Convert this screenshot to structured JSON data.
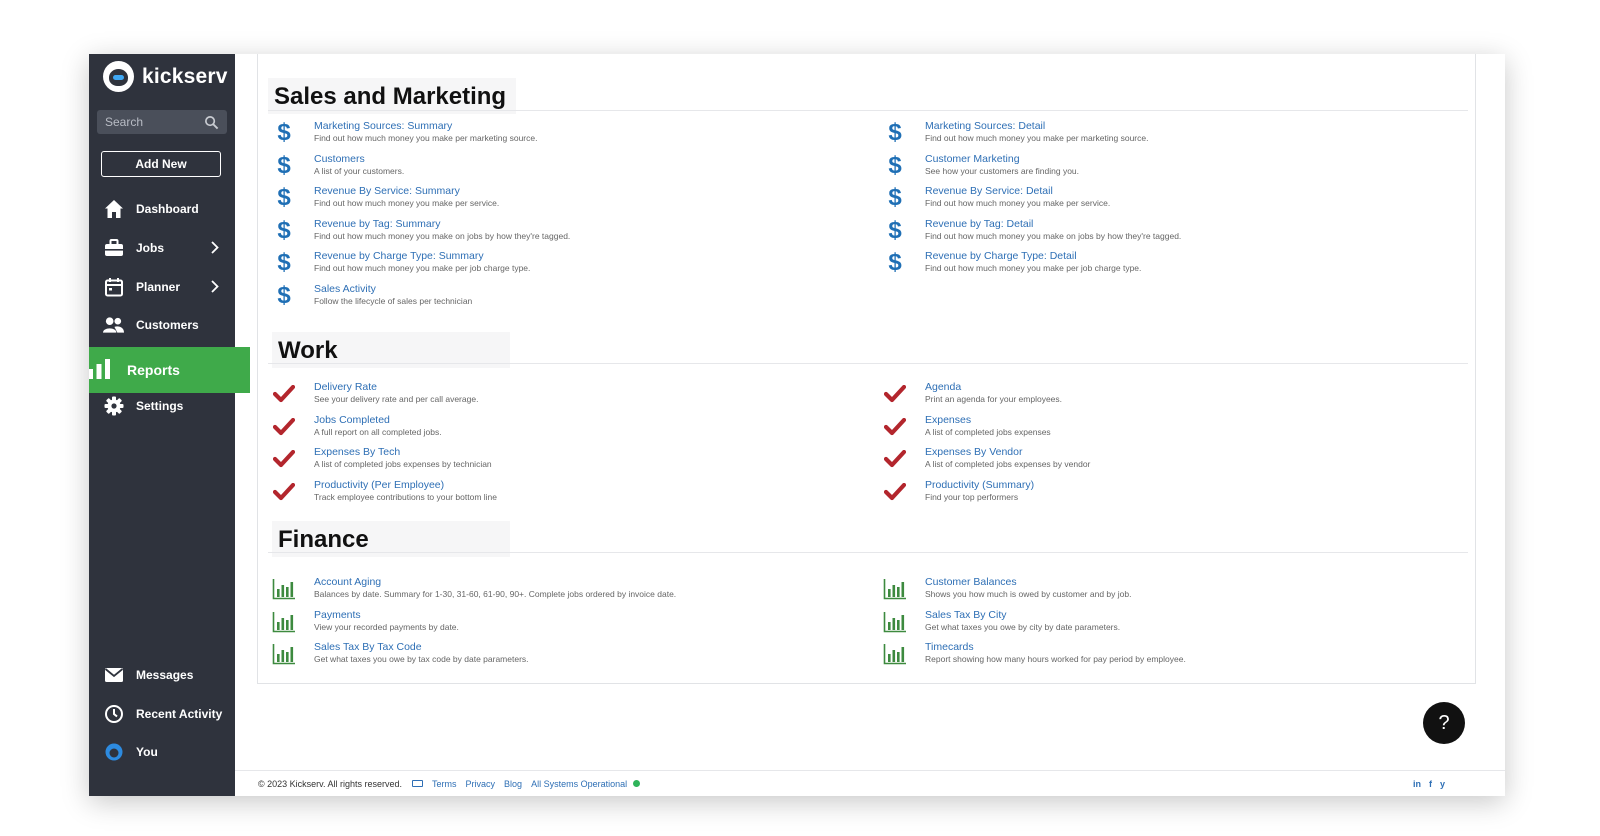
{
  "brand": {
    "name": "kickserv"
  },
  "search": {
    "placeholder": "Search"
  },
  "sidebar": {
    "add_new": "Add New",
    "items": [
      {
        "label": "Dashboard"
      },
      {
        "label": "Jobs"
      },
      {
        "label": "Planner"
      },
      {
        "label": "Customers"
      },
      {
        "label": "Reports"
      },
      {
        "label": "Settings"
      },
      {
        "label": "Messages"
      },
      {
        "label": "Recent Activity"
      },
      {
        "label": "You"
      }
    ]
  },
  "sections": {
    "sales": {
      "heading": "Sales and Marketing",
      "left": [
        {
          "title": "Marketing Sources: Summary",
          "desc": "Find out how much money you make per marketing source."
        },
        {
          "title": "Customers",
          "desc": "A list of your customers."
        },
        {
          "title": "Revenue By Service: Summary",
          "desc": "Find out how much money you make per service."
        },
        {
          "title": "Revenue by Tag: Summary",
          "desc": "Find out how much money you make on jobs by how they're tagged."
        },
        {
          "title": "Revenue by Charge Type: Summary",
          "desc": "Find out how much money you make per job charge type."
        },
        {
          "title": "Sales Activity",
          "desc": "Follow the lifecycle of sales per technician"
        }
      ],
      "right": [
        {
          "title": "Marketing Sources: Detail",
          "desc": "Find out how much money you make per marketing source."
        },
        {
          "title": "Customer Marketing",
          "desc": "See how your customers are finding you."
        },
        {
          "title": "Revenue By Service: Detail",
          "desc": "Find out how much money you make per service."
        },
        {
          "title": "Revenue by Tag: Detail",
          "desc": "Find out how much money you make on jobs by how they're tagged."
        },
        {
          "title": "Revenue by Charge Type: Detail",
          "desc": "Find out how much money you make per job charge type."
        }
      ]
    },
    "work": {
      "heading": "Work",
      "left": [
        {
          "title": "Delivery Rate",
          "desc": "See your delivery rate and per call average."
        },
        {
          "title": "Jobs Completed",
          "desc": "A full report on all completed jobs."
        },
        {
          "title": "Expenses By Tech",
          "desc": "A list of completed jobs expenses by technician"
        },
        {
          "title": "Productivity (Per Employee)",
          "desc": "Track employee contributions to your bottom line"
        }
      ],
      "right": [
        {
          "title": "Agenda",
          "desc": "Print an agenda for your employees."
        },
        {
          "title": "Expenses",
          "desc": "A list of completed jobs expenses"
        },
        {
          "title": "Expenses By Vendor",
          "desc": "A list of completed jobs expenses by vendor"
        },
        {
          "title": "Productivity (Summary)",
          "desc": "Find your top performers"
        }
      ]
    },
    "finance": {
      "heading": "Finance",
      "left": [
        {
          "title": "Account Aging",
          "desc": "Balances by date. Summary for 1-30, 31-60, 61-90, 90+. Complete jobs ordered by invoice date."
        },
        {
          "title": "Payments",
          "desc": "View your recorded payments by date."
        },
        {
          "title": "Sales Tax By Tax Code",
          "desc": "Get what taxes you owe by tax code by date parameters."
        }
      ],
      "right": [
        {
          "title": "Customer Balances",
          "desc": "Shows you how much is owed by customer and by job."
        },
        {
          "title": "Sales Tax By City",
          "desc": "Get what taxes you owe by city by date parameters."
        },
        {
          "title": "Timecards",
          "desc": "Report showing how many hours worked for pay period by employee."
        }
      ]
    }
  },
  "footer": {
    "copyright": "© 2023 Kickserv. All rights reserved.",
    "terms": "Terms",
    "privacy": "Privacy",
    "blog": "Blog",
    "status": "All Systems Operational",
    "social": [
      "in",
      "f",
      "y"
    ]
  },
  "help": {
    "label": "?"
  },
  "colors": {
    "sidebar": "#2f333d",
    "active": "#3faa4a",
    "link": "#2e6fb5",
    "check": "#b3262d",
    "dollar": "#1f6fb5",
    "chart": "#3d8a3f"
  }
}
